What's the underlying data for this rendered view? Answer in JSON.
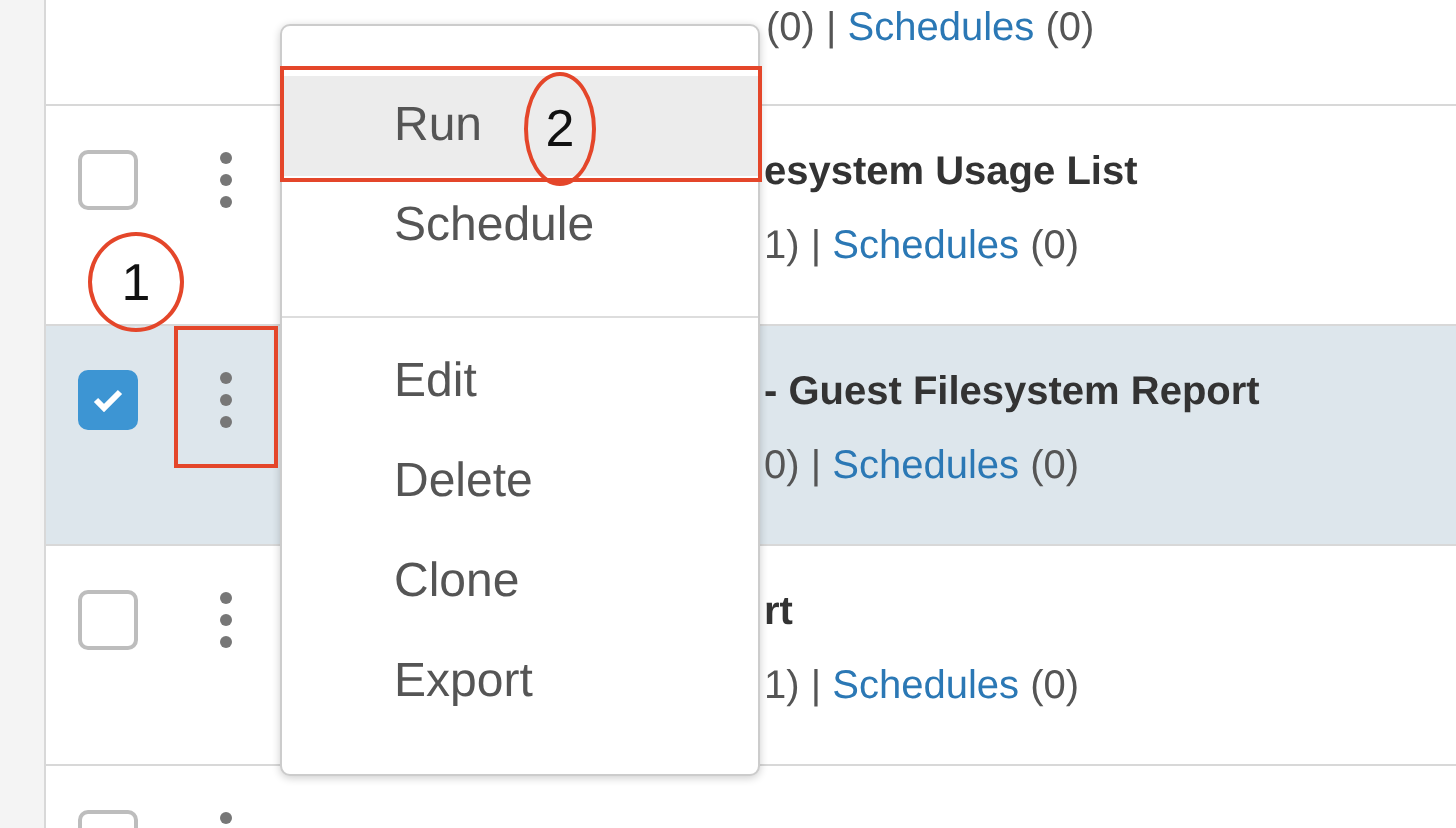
{
  "rows": [
    {
      "meta": {
        "prefix": "(0) |",
        "link": "Schedules",
        "suffix": "(0)"
      },
      "kind": "top"
    },
    {
      "kind": "full",
      "checked": false,
      "title": "esystem Usage List",
      "meta": {
        "prefix": "1) |",
        "link": "Schedules",
        "suffix": "(0)"
      }
    },
    {
      "kind": "full",
      "checked": true,
      "title": "- Guest Filesystem Report",
      "meta": {
        "prefix": "0) |",
        "link": "Schedules",
        "suffix": "(0)"
      }
    },
    {
      "kind": "full",
      "checked": false,
      "title": "rt",
      "meta": {
        "prefix": "1) |",
        "link": "Schedules",
        "suffix": "(0)"
      }
    },
    {
      "kind": "bottom",
      "checked": false
    }
  ],
  "menu": {
    "groups": [
      [
        {
          "label": "Run",
          "selected": true
        },
        {
          "label": "Schedule",
          "selected": false
        }
      ],
      [
        {
          "label": "Edit",
          "selected": false
        },
        {
          "label": "Delete",
          "selected": false
        },
        {
          "label": "Clone",
          "selected": false
        },
        {
          "label": "Export",
          "selected": false
        }
      ]
    ]
  },
  "annotations": [
    {
      "kind": "box"
    },
    {
      "kind": "circle",
      "label": "1"
    },
    {
      "kind": "box"
    },
    {
      "kind": "circle",
      "label": "2"
    }
  ]
}
